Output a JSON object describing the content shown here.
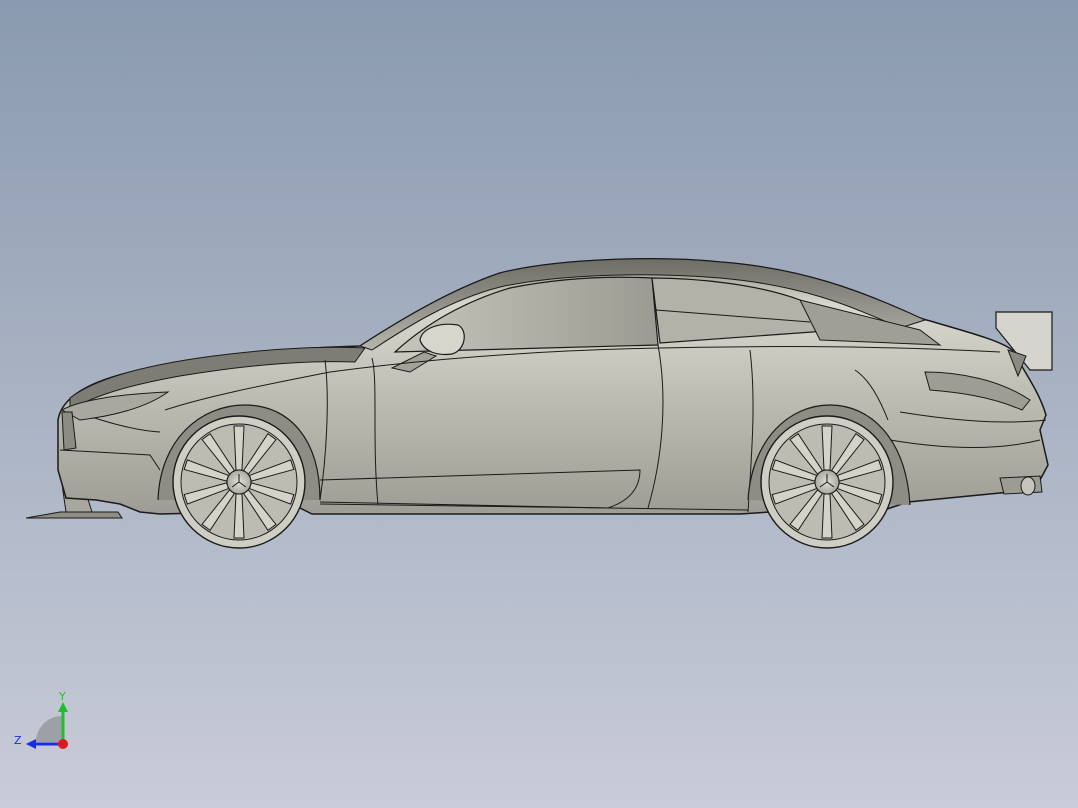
{
  "viewport": {
    "background_top": "#8a9aaf",
    "background_bottom": "#c9ccd8"
  },
  "model": {
    "name": "coupe-race-car-side-view",
    "body_color": "#c9c8bc",
    "edge_color": "#1a1a1a",
    "wing_color": "#d6d5cd"
  },
  "triad": {
    "y_label": "Y",
    "z_label": "Z",
    "y_color": "#1fbf2a",
    "z_color": "#1a2ee0",
    "x_color": "#e01a1a"
  }
}
